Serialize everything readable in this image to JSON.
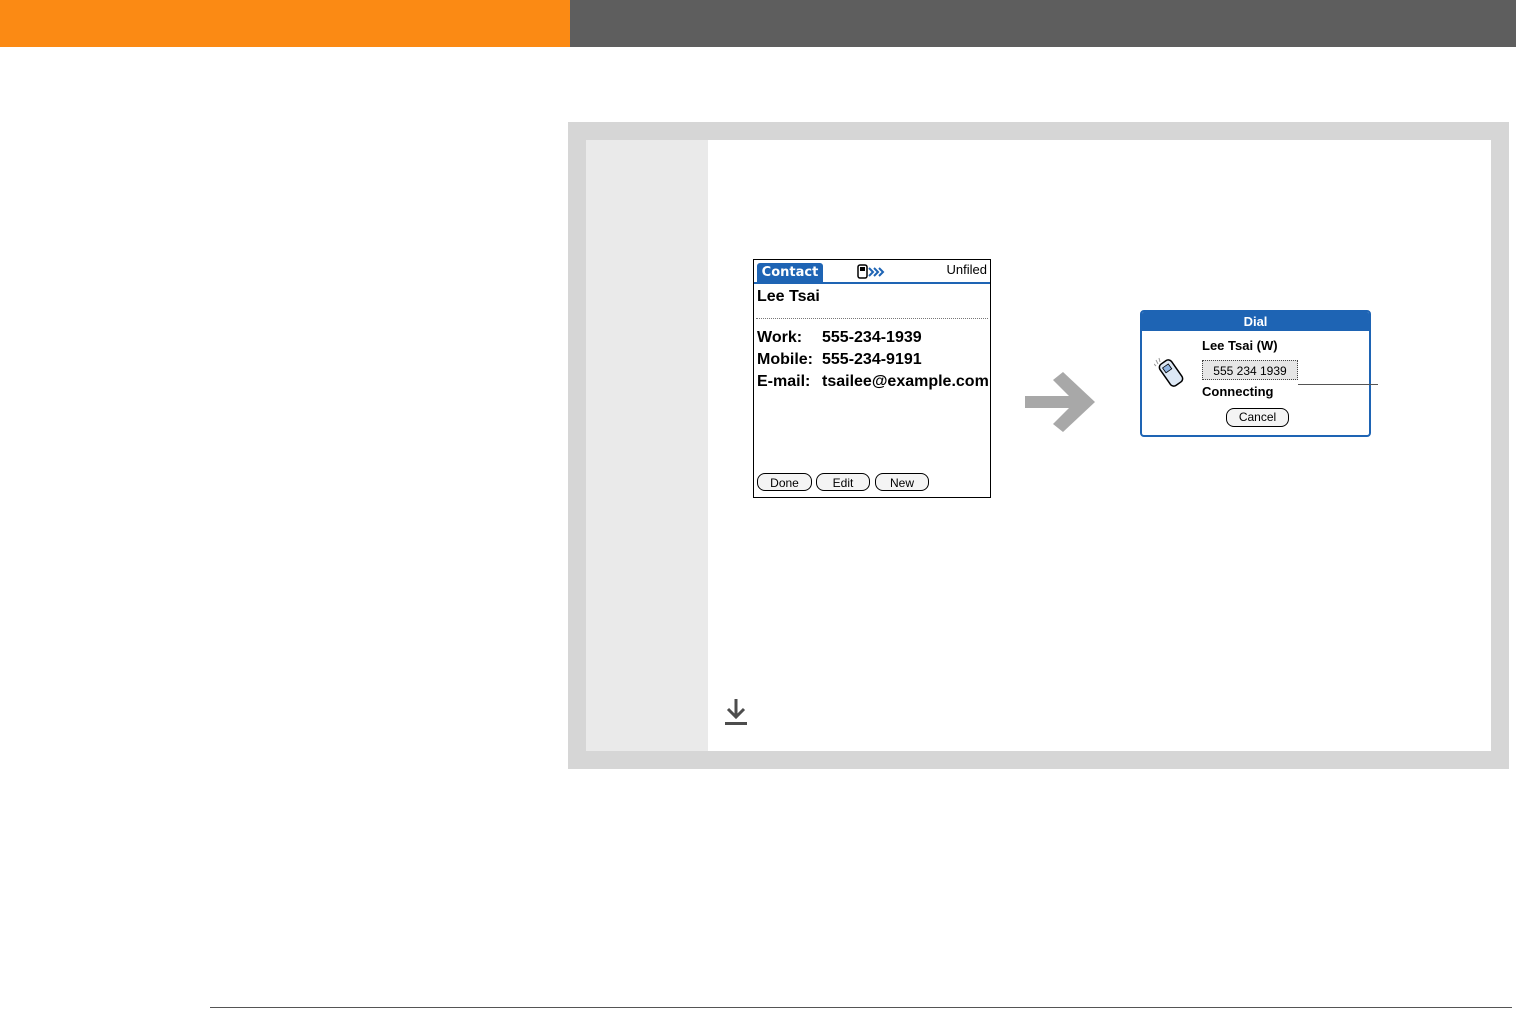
{
  "contact_screen": {
    "tab_label": "Contact",
    "category": "Unfiled",
    "name": "Lee Tsai",
    "fields": [
      {
        "label": "Work:",
        "value": "555-234-1939"
      },
      {
        "label": "Mobile:",
        "value": "555-234-9191"
      },
      {
        "label": "E-mail:",
        "value": "tsailee@example.com"
      }
    ],
    "buttons": {
      "done": "Done",
      "edit": "Edit",
      "new": "New"
    }
  },
  "dial_dialog": {
    "title": "Dial",
    "name": "Lee Tsai (W)",
    "number": "555 234 1939",
    "status": "Connecting",
    "cancel": "Cancel"
  },
  "colors": {
    "header_orange": "#fb8a14",
    "header_gray": "#5e5e5e",
    "palm_blue": "#1e64b4",
    "panel_border": "#d6d6d6"
  },
  "icons": [
    "phone-forward-icon",
    "arrow-right-icon",
    "cell-phone-icon",
    "download-arrow-icon"
  ]
}
